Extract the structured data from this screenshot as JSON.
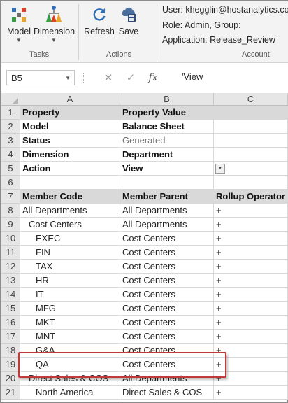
{
  "ribbon": {
    "tasks_group": "Tasks",
    "actions_group": "Actions",
    "account_group": "Account",
    "model_label": "Model",
    "dimension_label": "Dimension",
    "refresh_label": "Refresh",
    "save_label": "Save",
    "user_line": "User: khegglin@hostanalytics.com",
    "role_line": "Role: Admin, Group:",
    "app_line": "Application: Release_Review"
  },
  "formula_bar": {
    "name_box": "B5",
    "formula": "'View"
  },
  "columns": [
    "A",
    "B",
    "C"
  ],
  "rows": [
    {
      "num": "1",
      "a": "Property",
      "b": "Property Value",
      "c": ""
    },
    {
      "num": "2",
      "a": "Model",
      "b": "Balance Sheet",
      "c": ""
    },
    {
      "num": "3",
      "a": "Status",
      "b": "Generated",
      "c": ""
    },
    {
      "num": "4",
      "a": "Dimension",
      "b": "Department",
      "c": ""
    },
    {
      "num": "5",
      "a": "Action",
      "b": "View",
      "c": ""
    },
    {
      "num": "6",
      "a": "",
      "b": "",
      "c": ""
    },
    {
      "num": "7",
      "a": "Member Code",
      "b": "Member Parent",
      "c": "Rollup Operator"
    },
    {
      "num": "8",
      "a": "All Departments",
      "b": "All Departments",
      "c": "+"
    },
    {
      "num": "9",
      "a": "Cost Centers",
      "b": "All Departments",
      "c": "+"
    },
    {
      "num": "10",
      "a": "EXEC",
      "b": "Cost Centers",
      "c": "+"
    },
    {
      "num": "11",
      "a": "FIN",
      "b": "Cost Centers",
      "c": "+"
    },
    {
      "num": "12",
      "a": "TAX",
      "b": "Cost Centers",
      "c": "+"
    },
    {
      "num": "13",
      "a": "HR",
      "b": "Cost Centers",
      "c": "+"
    },
    {
      "num": "14",
      "a": "IT",
      "b": "Cost Centers",
      "c": "+"
    },
    {
      "num": "15",
      "a": "MFG",
      "b": "Cost Centers",
      "c": "+"
    },
    {
      "num": "16",
      "a": "MKT",
      "b": "Cost Centers",
      "c": "+"
    },
    {
      "num": "17",
      "a": "MNT",
      "b": "Cost Centers",
      "c": "+"
    },
    {
      "num": "18",
      "a": "G&A",
      "b": "Cost Centers",
      "c": "+"
    },
    {
      "num": "19",
      "a": "QA",
      "b": "Cost Centers",
      "c": "+"
    },
    {
      "num": "20",
      "a": "Direct Sales & COS",
      "b": "All Departments",
      "c": "+"
    },
    {
      "num": "21",
      "a": "North America",
      "b": "Direct Sales & COS",
      "c": "+"
    }
  ]
}
